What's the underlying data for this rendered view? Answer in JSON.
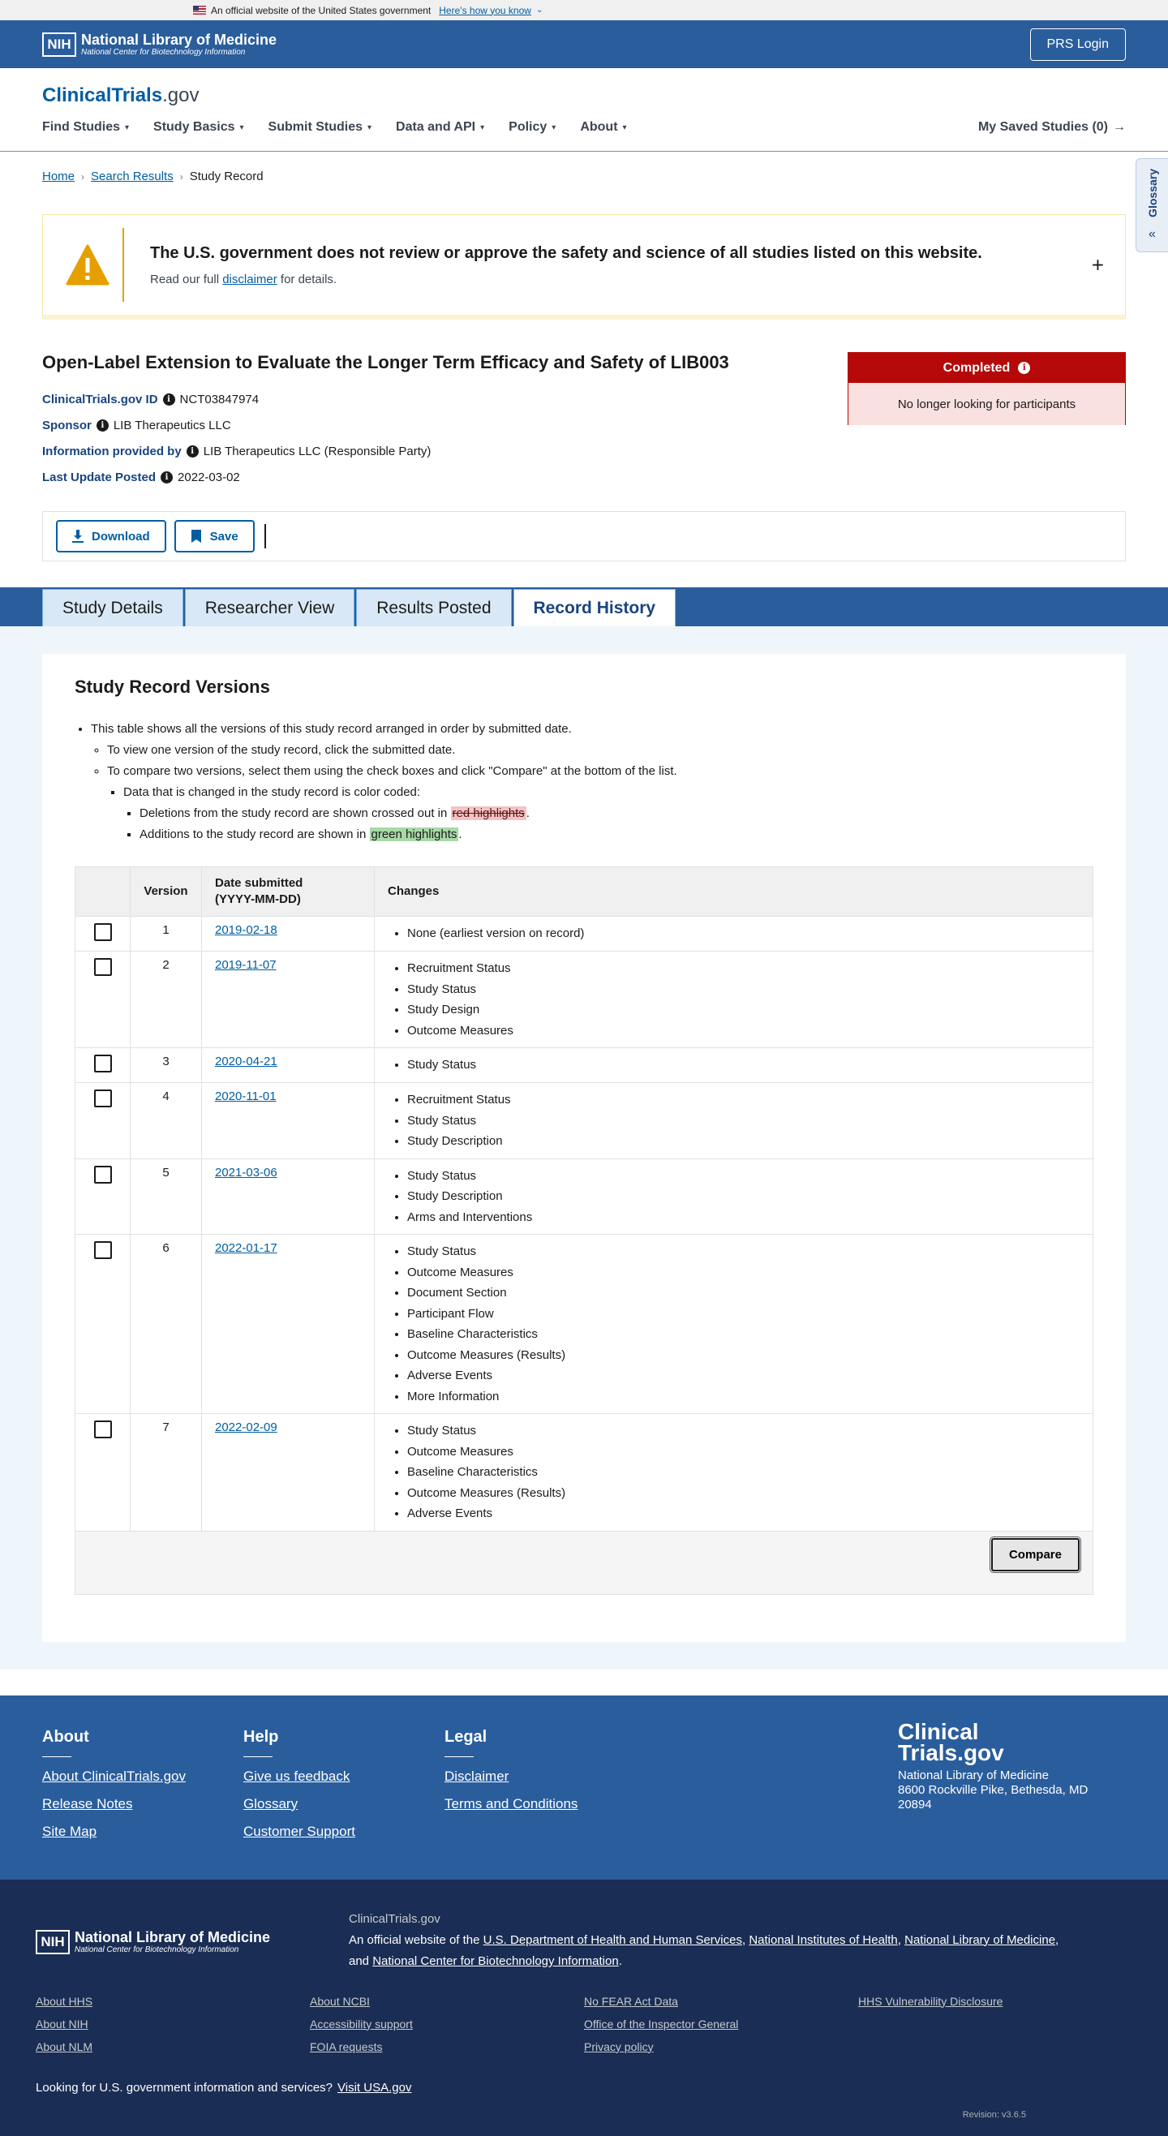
{
  "gov_banner": {
    "text": "An official website of the United States government",
    "link": "Here's how you know"
  },
  "nih_header": {
    "box": "NIH",
    "line1": "National Library of Medicine",
    "line2": "National Center for Biotechnology Information",
    "login": "PRS Login"
  },
  "brand": {
    "main": "ClinicalTrials",
    "suffix": ".gov"
  },
  "nav": {
    "items": [
      "Find Studies",
      "Study Basics",
      "Submit Studies",
      "Data and API",
      "Policy",
      "About"
    ],
    "saved": "My Saved Studies (0)"
  },
  "glossary": "Glossary",
  "breadcrumb": {
    "home": "Home",
    "search": "Search Results",
    "current": "Study Record"
  },
  "alert": {
    "title": "The U.S. government does not review or approve the safety and science of all studies listed on this website.",
    "pre": "Read our full ",
    "link": "disclaimer",
    "post": " for details."
  },
  "study": {
    "title": "Open-Label Extension to Evaluate the Longer Term Efficacy and Safety of LIB003",
    "id_label": "ClinicalTrials.gov ID",
    "id_value": "NCT03847974",
    "sponsor_label": "Sponsor",
    "sponsor_value": "LIB Therapeutics LLC",
    "provided_label": "Information provided by",
    "provided_value": "LIB Therapeutics LLC (Responsible Party)",
    "update_label": "Last Update Posted",
    "update_value": "2022-03-02",
    "status": "Completed",
    "status_sub": "No longer looking for participants"
  },
  "actions": {
    "download": "Download",
    "save": "Save"
  },
  "tabs": [
    "Study Details",
    "Researcher View",
    "Results Posted",
    "Record History"
  ],
  "versions": {
    "heading": "Study Record Versions",
    "b1": "This table shows all the versions of this study record arranged in order by submitted date.",
    "b2": "To view one version of the study record, click the submitted date.",
    "b3": "To compare two versions, select them using the check boxes and click \"Compare\" at the bottom of the list.",
    "b4": "Data that is changed in the study record is color coded:",
    "b5_pre": "Deletions from the study record are shown crossed out in ",
    "b5_hl": "red highlights",
    "b6_pre": "Additions to the study record are shown in ",
    "b6_hl": "green highlights",
    "period": ".",
    "col_version": "Version",
    "col_date_1": "Date submitted",
    "col_date_2": "(YYYY-MM-DD)",
    "col_changes": "Changes",
    "compare": "Compare",
    "rows": [
      {
        "version": "1",
        "date": "2019-02-18",
        "changes": [
          "None (earliest version on record)"
        ]
      },
      {
        "version": "2",
        "date": "2019-11-07",
        "changes": [
          "Recruitment Status",
          "Study Status",
          "Study Design",
          "Outcome Measures"
        ]
      },
      {
        "version": "3",
        "date": "2020-04-21",
        "changes": [
          "Study Status"
        ]
      },
      {
        "version": "4",
        "date": "2020-11-01",
        "changes": [
          "Recruitment Status",
          "Study Status",
          "Study Description"
        ]
      },
      {
        "version": "5",
        "date": "2021-03-06",
        "changes": [
          "Study Status",
          "Study Description",
          "Arms and Interventions"
        ]
      },
      {
        "version": "6",
        "date": "2022-01-17",
        "changes": [
          "Study Status",
          "Outcome Measures",
          "Document Section",
          "Participant Flow",
          "Baseline Characteristics",
          "Outcome Measures (Results)",
          "Adverse Events",
          "More Information"
        ]
      },
      {
        "version": "7",
        "date": "2022-02-09",
        "changes": [
          "Study Status",
          "Outcome Measures",
          "Baseline Characteristics",
          "Outcome Measures (Results)",
          "Adverse Events"
        ]
      }
    ]
  },
  "footer": {
    "about_h": "About",
    "about_links": [
      "About ClinicalTrials.gov",
      "Release Notes",
      "Site Map"
    ],
    "help_h": "Help",
    "help_links": [
      "Give us feedback",
      "Glossary",
      "Customer Support"
    ],
    "legal_h": "Legal",
    "legal_links": [
      "Disclaimer",
      "Terms and Conditions"
    ],
    "addr_big_1": "Clinical",
    "addr_big_2": "Trials.gov",
    "addr_1": "National Library of Medicine",
    "addr_2": "8600 Rockville Pike, Bethesda, MD",
    "addr_3": "20894"
  },
  "footer_bottom": {
    "site": "ClinicalTrials.gov",
    "official_pre": "An official website of the ",
    "hhs": "U.S. Department of Health and Human Services",
    "nih": "National Institutes of Health",
    "nlm": "National Library of Medicine",
    "and": "and ",
    "ncbi": "National Center for Biotechnology Information",
    "col1": [
      "About HHS",
      "About NIH",
      "About NLM"
    ],
    "col2": [
      "About NCBI",
      "Accessibility support",
      "FOIA requests"
    ],
    "col3": [
      "No FEAR Act Data",
      "Office of the Inspector General",
      "Privacy policy"
    ],
    "col4": [
      "HHS Vulnerability Disclosure"
    ],
    "usa_text": "Looking for U.S. government information and services?",
    "usa_link": "Visit USA.gov",
    "revision": "Revision: v3.6.5"
  }
}
